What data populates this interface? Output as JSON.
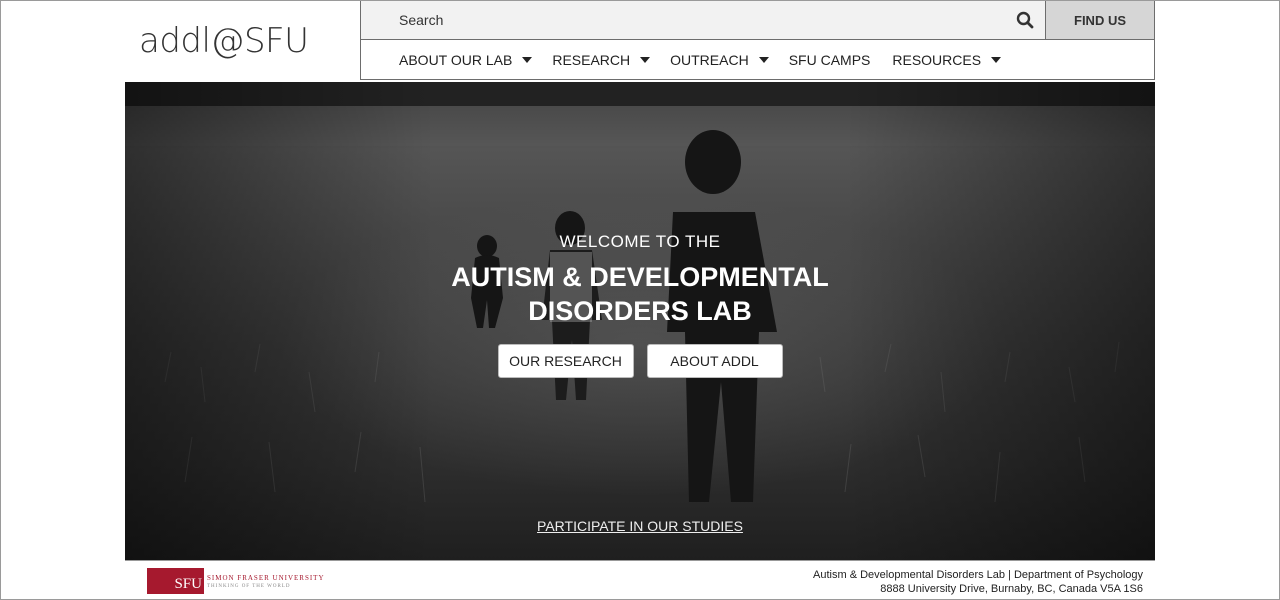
{
  "header": {
    "logo_text": "addl@SFU",
    "search_placeholder": "Search",
    "find_us_label": "FIND US",
    "nav": [
      {
        "label": "ABOUT OUR LAB",
        "has_dropdown": true
      },
      {
        "label": "RESEARCH",
        "has_dropdown": true
      },
      {
        "label": "OUTREACH",
        "has_dropdown": true
      },
      {
        "label": "SFU CAMPS",
        "has_dropdown": false
      },
      {
        "label": "RESOURCES",
        "has_dropdown": true
      }
    ]
  },
  "hero": {
    "welcome": "WELCOME TO THE",
    "title_line1": "AUTISM & DEVELOPMENTAL",
    "title_line2": "DISORDERS LAB",
    "buttons": [
      "OUR RESEARCH",
      "ABOUT ADDL"
    ],
    "participate_link": "PARTICIPATE IN OUR STUDIES"
  },
  "footer": {
    "sfu_mark": "SFU",
    "sfu_name": "SIMON FRASER UNIVERSITY",
    "sfu_tagline": "THINKING OF THE WORLD",
    "line1": "Autism & Developmental Disorders Lab | Department of Psychology",
    "line2": "8888 University Drive, Burnaby, BC, Canada V5A 1S6"
  },
  "colors": {
    "sfu_red": "#a6192e",
    "find_us_bg": "#d6d6d6",
    "search_bg": "#f2f2f2"
  },
  "icons": {
    "search": "search-icon",
    "dropdown": "caret-down-icon"
  }
}
